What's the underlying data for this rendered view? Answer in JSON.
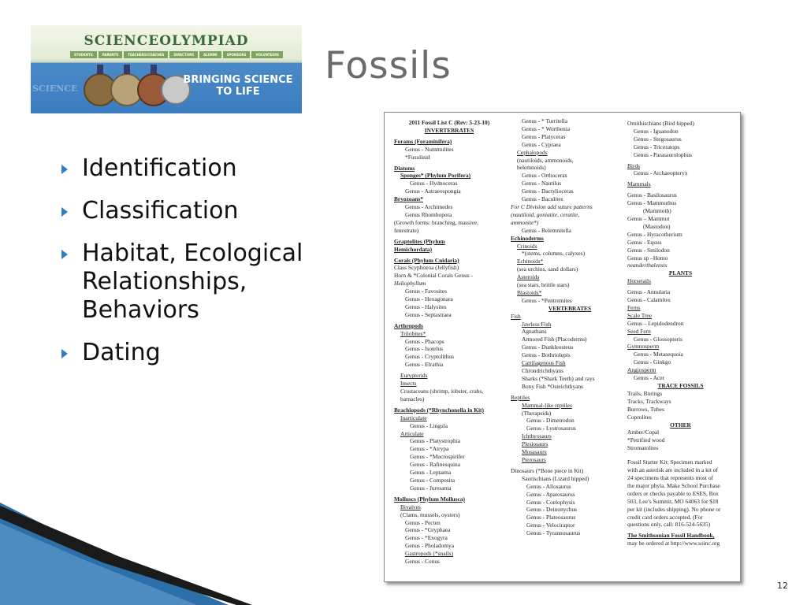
{
  "banner": {
    "logo_text": "SCIENCEOLYMPIAD",
    "nav_items": [
      "STUDENTS",
      "PARENTS",
      "TEACHERS/COACHES",
      "DIRECTORS",
      "ALUMNI",
      "SPONSORS",
      "VOLUNTEERS"
    ],
    "tagline_line1": "BRINGING SCIENCE",
    "tagline_line2": "TO LIFE",
    "watermark": "SCIENCE"
  },
  "title": "Fossils",
  "bullets": [
    "Identification",
    "Classification",
    "Habitat, Ecological Relationships, Behaviors",
    "Dating"
  ],
  "fossil_list": {
    "col1": [
      {
        "t": "2011 Fossil List C (Rev: 5-23-10)",
        "s": "c"
      },
      {
        "t": "INVERTEBRATES",
        "s": "c u"
      },
      {
        "t": "",
        "s": "gap"
      },
      {
        "t": "Forams (Foraminifera)",
        "s": "h"
      },
      {
        "t": "Genus - Nummulites",
        "s": "i2"
      },
      {
        "t": "*Fusulinid",
        "s": "i2"
      },
      {
        "t": "",
        "s": "gap"
      },
      {
        "t": "Diatoms",
        "s": "h"
      },
      {
        "t": "Sponges* (Phylum Porifera)",
        "s": "h i1"
      },
      {
        "t": "Genus - Hydnoceras",
        "s": "i3"
      },
      {
        "t": "Genus - Astraeospongia",
        "s": "i2"
      },
      {
        "t": "Bryozoans*",
        "s": "h"
      },
      {
        "t": "Genus - Archimedes",
        "s": "i2"
      },
      {
        "t": "Genus Rhombopora",
        "s": "i2"
      },
      {
        "t": "(Growth forms: branching, massive,",
        "s": ""
      },
      {
        "t": "fenestrate)",
        "s": ""
      },
      {
        "t": "",
        "s": "gap"
      },
      {
        "t": "Graptolites (Phylum",
        "s": "h"
      },
      {
        "t": "Hemichordata)",
        "s": "h"
      },
      {
        "t": "",
        "s": "gap"
      },
      {
        "t": "Corals (Phylum Cnidaria)",
        "s": "h"
      },
      {
        "t": "Class Scyphozoa (Jellyfish)",
        "s": ""
      },
      {
        "t": "Horn & *Colonial Corals Genus -",
        "s": ""
      },
      {
        "t": "Heliophyllum",
        "s": "it"
      },
      {
        "t": "Genus - Favosites",
        "s": "i2"
      },
      {
        "t": "Genus - Hexagonara",
        "s": "i2"
      },
      {
        "t": "Genus - Halysites",
        "s": "i2"
      },
      {
        "t": "Genus - Septastraea",
        "s": "i2"
      },
      {
        "t": "",
        "s": "gap"
      },
      {
        "t": "Arthropods",
        "s": "h"
      },
      {
        "t": "Trilobites*",
        "s": "u i1"
      },
      {
        "t": "Genus - Phacops",
        "s": "i2"
      },
      {
        "t": "Genus - Isotelus",
        "s": "i2"
      },
      {
        "t": "Genus - Cryptolithus",
        "s": "i2"
      },
      {
        "t": "Genus - Elrathia",
        "s": "i2"
      },
      {
        "t": "",
        "s": "gap"
      },
      {
        "t": "Eurypterids",
        "s": "u i1"
      },
      {
        "t": "Insects",
        "s": "u i1"
      },
      {
        "t": "Crustaceans (shrimp, lobster, crabs,",
        "s": "i1"
      },
      {
        "t": "barnacles)",
        "s": "i1"
      },
      {
        "t": "",
        "s": "gap"
      },
      {
        "t": "Brachiopods (*Rhynchonella in Kit)",
        "s": "h"
      },
      {
        "t": "Inarticulate",
        "s": "u i1"
      },
      {
        "t": "Genus - Lingula",
        "s": "i3"
      },
      {
        "t": "Articulate",
        "s": "u i1"
      },
      {
        "t": "Genus - Platystrophia",
        "s": "i3"
      },
      {
        "t": "Genus - *Atrypa",
        "s": "i3"
      },
      {
        "t": "Genus - *Mucrospirifer",
        "s": "i3"
      },
      {
        "t": "Genus - Rafinesquina",
        "s": "i3"
      },
      {
        "t": "Genus - Leptaena",
        "s": "i3"
      },
      {
        "t": "Genus - Composita",
        "s": "i3"
      },
      {
        "t": "Genus - Juresania",
        "s": "i3"
      },
      {
        "t": "",
        "s": "gap"
      },
      {
        "t": "Molluscs (Phylum Mollusca)",
        "s": "h"
      },
      {
        "t": "Bivalves",
        "s": "u i1"
      },
      {
        "t": "(Clams, mussels, oysters)",
        "s": "i1"
      },
      {
        "t": "Genus - Pecten",
        "s": "i2"
      },
      {
        "t": "Genus - *Gryphaea",
        "s": "i2"
      },
      {
        "t": "Genus - *Exogyra",
        "s": "i2"
      },
      {
        "t": "Genus - Pholadomya",
        "s": "i2"
      },
      {
        "t": "Gastropods (*snails)",
        "s": "u i2"
      },
      {
        "t": "Genus - Conus",
        "s": "i2"
      }
    ],
    "col2": [
      {
        "t": "Genus - * Turritella",
        "s": "i2"
      },
      {
        "t": "Genus - * Worthenia",
        "s": "i2"
      },
      {
        "t": "Genus - Platyceras",
        "s": "i2"
      },
      {
        "t": "Genus - Cypraea",
        "s": "i2"
      },
      {
        "t": "Cephalopods",
        "s": "u i1"
      },
      {
        "t": "(nautiloids, ammonoids,",
        "s": "i1"
      },
      {
        "t": "belemnoids)",
        "s": "i1"
      },
      {
        "t": "Genus - Orthoceras",
        "s": "i2"
      },
      {
        "t": "Genus - Nautilus",
        "s": "i2"
      },
      {
        "t": "Genus - Dactylioceras",
        "s": "i2"
      },
      {
        "t": "Genus - Baculites",
        "s": "i2"
      },
      {
        "t": "For C Division add suture patterns",
        "s": "it"
      },
      {
        "t": "(nautiloid, goniatite, ceratite,",
        "s": "it"
      },
      {
        "t": "ammonite*)",
        "s": "it"
      },
      {
        "t": "Genus - Belemnitella",
        "s": "i2"
      },
      {
        "t": "Echinoderms",
        "s": "h"
      },
      {
        "t": "Crinoids",
        "s": "u i1"
      },
      {
        "t": "*(stems, columns, calyxes)",
        "s": "i2"
      },
      {
        "t": "Echinoids*",
        "s": "u i1"
      },
      {
        "t": "(sea urchins, sand dollars)",
        "s": "i1"
      },
      {
        "t": "Asteroids",
        "s": "u i1"
      },
      {
        "t": "(sea stars, brittle stars)",
        "s": "i1"
      },
      {
        "t": "Blastoids*",
        "s": "u i1"
      },
      {
        "t": "Genus - *Pentremites",
        "s": "i2"
      },
      {
        "t": "VERTEBRATES",
        "s": "c u"
      },
      {
        "t": "Fish",
        "s": "u"
      },
      {
        "t": "Jawless Fish",
        "s": "u i2"
      },
      {
        "t": "Agnathans",
        "s": "i2"
      },
      {
        "t": "Armored Fish (Placoderms)",
        "s": "i2"
      },
      {
        "t": "Genus - Dunkleosteus",
        "s": "i2"
      },
      {
        "t": "Genus - Bothriolepis",
        "s": "i2"
      },
      {
        "t": "Cartilagenous Fish",
        "s": "u i2"
      },
      {
        "t": "Chrondrichthyans",
        "s": "i2"
      },
      {
        "t": "Sharks (*Shark Teeth) and rays",
        "s": "i2"
      },
      {
        "t": "Bony Fish *Osteichthyans",
        "s": "i2"
      },
      {
        "t": "",
        "s": "gap"
      },
      {
        "t": "Reptiles",
        "s": "u"
      },
      {
        "t": "Mammal-like reptiles",
        "s": "u i2"
      },
      {
        "t": "(Therapsids)",
        "s": "i2"
      },
      {
        "t": "Genus - Dimetrodon",
        "s": "i3"
      },
      {
        "t": "Genus - Lystrosaurus",
        "s": "i3"
      },
      {
        "t": "Ichthyosaurs",
        "s": "u i2"
      },
      {
        "t": "Plesiosaurs",
        "s": "u i2"
      },
      {
        "t": "Mosasaurs",
        "s": "u i2"
      },
      {
        "t": "Pterosaurs",
        "s": "u i2"
      },
      {
        "t": "",
        "s": "gap"
      },
      {
        "t": "Dinosaurs (*Bone piece in Kit)",
        "s": ""
      },
      {
        "t": "Saurischians (Lizard hipped)",
        "s": "i2"
      },
      {
        "t": "Genus - Allosaurus",
        "s": "i3"
      },
      {
        "t": "Genus - Apatosaurus",
        "s": "i3"
      },
      {
        "t": "Genus - Coelophysis",
        "s": "i3"
      },
      {
        "t": "Genus - Deinonychus",
        "s": "i3"
      },
      {
        "t": "Genus - Plateosaurus",
        "s": "i3"
      },
      {
        "t": "Genus - Velociraptor",
        "s": "i3"
      },
      {
        "t": "Genus - Tyrannosaurus",
        "s": "i3"
      }
    ],
    "col3": [
      {
        "t": "Ornithischians (Bird hipped)",
        "s": ""
      },
      {
        "t": "Genus - Iguanodon",
        "s": "i1"
      },
      {
        "t": "Genus - Stegosaurus",
        "s": "i1"
      },
      {
        "t": "Genus - Triceratops",
        "s": "i1"
      },
      {
        "t": "Genus - Parasaurolophus",
        "s": "i1"
      },
      {
        "t": "",
        "s": "gap"
      },
      {
        "t": "Birds",
        "s": "u"
      },
      {
        "t": "Genus - Archaeopteryx",
        "s": "i1"
      },
      {
        "t": "",
        "s": "gap"
      },
      {
        "t": "Mammals",
        "s": "u"
      },
      {
        "t": "",
        "s": "gap"
      },
      {
        "t": "Genus - Basilosaurus",
        "s": ""
      },
      {
        "t": "Genus - Mammuthus",
        "s": ""
      },
      {
        "t": "(Mammoth)",
        "s": "i3"
      },
      {
        "t": "Genus – Mammut",
        "s": ""
      },
      {
        "t": "(Mastodon)",
        "s": "i3"
      },
      {
        "t": "Genus - Hyracotherium",
        "s": ""
      },
      {
        "t": "Genus - Equus",
        "s": ""
      },
      {
        "t": "Genus - Smilodon",
        "s": ""
      },
      {
        "t": "Genus sp –Homo",
        "s": ""
      },
      {
        "t": "neanderthalensis",
        "s": "it"
      },
      {
        "t": "PLANTS",
        "s": "c u"
      },
      {
        "t": "Horsetails",
        "s": "u"
      },
      {
        "t": "",
        "s": "gap"
      },
      {
        "t": "Genus - Annularia",
        "s": ""
      },
      {
        "t": "Genus - Calamites",
        "s": ""
      },
      {
        "t": "Ferns",
        "s": "u"
      },
      {
        "t": "Scale Tree",
        "s": "u"
      },
      {
        "t": "Genus – Lepidodendron",
        "s": ""
      },
      {
        "t": "Seed Fern",
        "s": "u"
      },
      {
        "t": "Genus - Glossopteris",
        "s": "i1"
      },
      {
        "t": "Gymnosperm",
        "s": "u"
      },
      {
        "t": "Genus - Metasequoia",
        "s": "i1"
      },
      {
        "t": "Genus - Ginkgo",
        "s": "i1"
      },
      {
        "t": "Angiosperm",
        "s": "u"
      },
      {
        "t": "Genus - Acer",
        "s": "i1"
      },
      {
        "t": "TRACE FOSSILS",
        "s": "c u"
      },
      {
        "t": "Trails, Borings",
        "s": ""
      },
      {
        "t": "Tracks, Trackways",
        "s": ""
      },
      {
        "t": "Burrows, Tubes",
        "s": ""
      },
      {
        "t": "Coprolites",
        "s": ""
      },
      {
        "t": "OTHER",
        "s": "c u"
      },
      {
        "t": "Amber/Copal",
        "s": ""
      },
      {
        "t": "*Petrified wood",
        "s": ""
      },
      {
        "t": "Stromatolites",
        "s": ""
      },
      {
        "t": "",
        "s": "gap"
      },
      {
        "t": "",
        "s": "gap"
      },
      {
        "t": "Fossil Starter Kit: Specimen marked",
        "s": ""
      },
      {
        "t": "with an asterisk are included in a kit of",
        "s": ""
      },
      {
        "t": "24 specimens that represents most of",
        "s": ""
      },
      {
        "t": "the major phyla. Make School Purchase",
        "s": ""
      },
      {
        "t": "orders or checks payable to ESES, Box",
        "s": ""
      },
      {
        "t": "503, Lee’s Summit, MO 64063 for $18",
        "s": ""
      },
      {
        "t": "per kit (includes shipping). No phone or",
        "s": ""
      },
      {
        "t": "credit card orders accepted. (For",
        "s": ""
      },
      {
        "t": "questions only, call: 816-524-5635)",
        "s": ""
      },
      {
        "t": "",
        "s": "gap"
      },
      {
        "t": "The Smithsonian Fossil Handbook,",
        "s": "h"
      },
      {
        "t": "may be ordered at http://www.soinc.org",
        "s": ""
      }
    ]
  },
  "page_number": "12",
  "colors": {
    "title": "#6b6b6b",
    "bullet_arrow": "#2f7fc7",
    "decor_dark": "#1a1a1a",
    "decor_blue": "#2d6fa8"
  }
}
